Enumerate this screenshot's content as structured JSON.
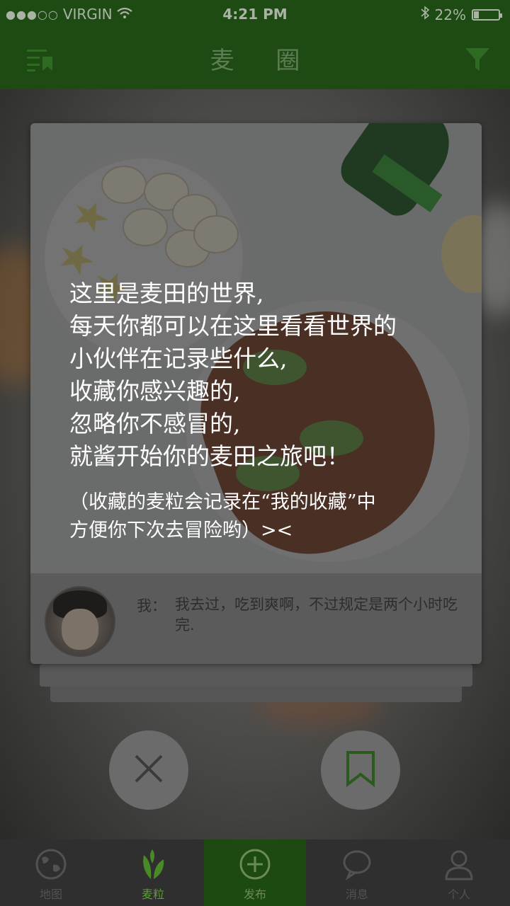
{
  "status_bar": {
    "signal": "●●●○○",
    "carrier": "VIRGIN",
    "time": "4:21 PM",
    "battery": "22%",
    "battery_level": 0.22
  },
  "nav": {
    "title": "麦 圈",
    "left_icon": "list-bookmark-icon",
    "right_icon": "filter-icon"
  },
  "intro": {
    "lines": [
      "这里是麦田的世界,",
      "每天你都可以在这里看看世界的",
      "小伙伴在记录些什么,",
      "收藏你感兴趣的,",
      "忽略你不感冒的,",
      "就酱开始你的麦田之旅吧！"
    ],
    "note_lines": [
      "（收藏的麦粒会记录在“我的收藏”中",
      "方便你下次去冒险哟）><"
    ]
  },
  "comment": {
    "user": "我：",
    "text": "我去过，吃到爽啊，不过规定是两个小时吃完."
  },
  "actions": {
    "dismiss_icon": "close-icon",
    "save_icon": "bookmark-icon"
  },
  "tabs": [
    {
      "label": "地图",
      "icon": "globe-icon"
    },
    {
      "label": "麦粒",
      "icon": "leaf-icon"
    },
    {
      "label": "发布",
      "icon": "plus-circle-icon"
    },
    {
      "label": "消息",
      "icon": "chat-bubble-icon"
    },
    {
      "label": "个人",
      "icon": "person-icon"
    }
  ],
  "colors": {
    "accent_green": "#1e4a14",
    "active_tab": "#5aa030"
  }
}
